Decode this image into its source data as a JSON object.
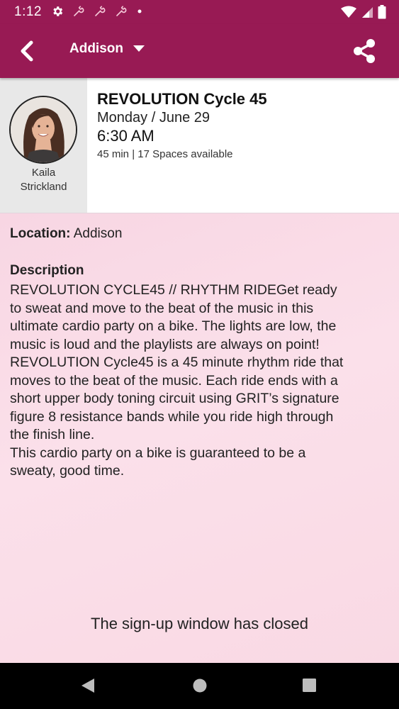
{
  "status_bar": {
    "time": "1:12",
    "icons_left": [
      "gear-icon",
      "wrench-icon",
      "wrench-icon",
      "wrench-icon",
      "dot-icon"
    ],
    "icons_right": [
      "wifi-icon",
      "signal-icon",
      "battery-icon"
    ]
  },
  "app_bar": {
    "location": "Addison",
    "icons": [
      "back-icon",
      "dropdown-icon",
      "share-icon"
    ],
    "color": "#981a54"
  },
  "class_info": {
    "instructor": {
      "first_name": "Kaila",
      "last_name": "Strickland"
    },
    "title": "REVOLUTION Cycle 45",
    "date": "Monday / June 29",
    "time": "6:30 AM",
    "meta": "45 min | 17 Spaces available"
  },
  "details": {
    "location_label": "Location:",
    "location_value": " Addison",
    "description_heading": "Description",
    "description_lines": [
      "REVOLUTION CYCLE45 // RHYTHM RIDEGet ready",
      "to sweat and move to the beat of the music in this",
      "ultimate cardio party on a bike. The lights are low, the",
      "music is loud and the playlists are always on point!",
      "REVOLUTION Cycle45 is a 45 minute rhythm ride that",
      "moves to the beat of the music. Each ride ends with a",
      "short upper body toning circuit using GRIT’s signature",
      "figure 8 resistance bands while you ride high through",
      "the finish line.",
      "This cardio party on a bike is guaranteed to be a",
      "sweaty, good time."
    ]
  },
  "signup_status": "The sign-up window has closed",
  "nav_bar": {
    "icons": [
      "nav-back-icon",
      "nav-home-icon",
      "nav-recents-icon"
    ]
  }
}
